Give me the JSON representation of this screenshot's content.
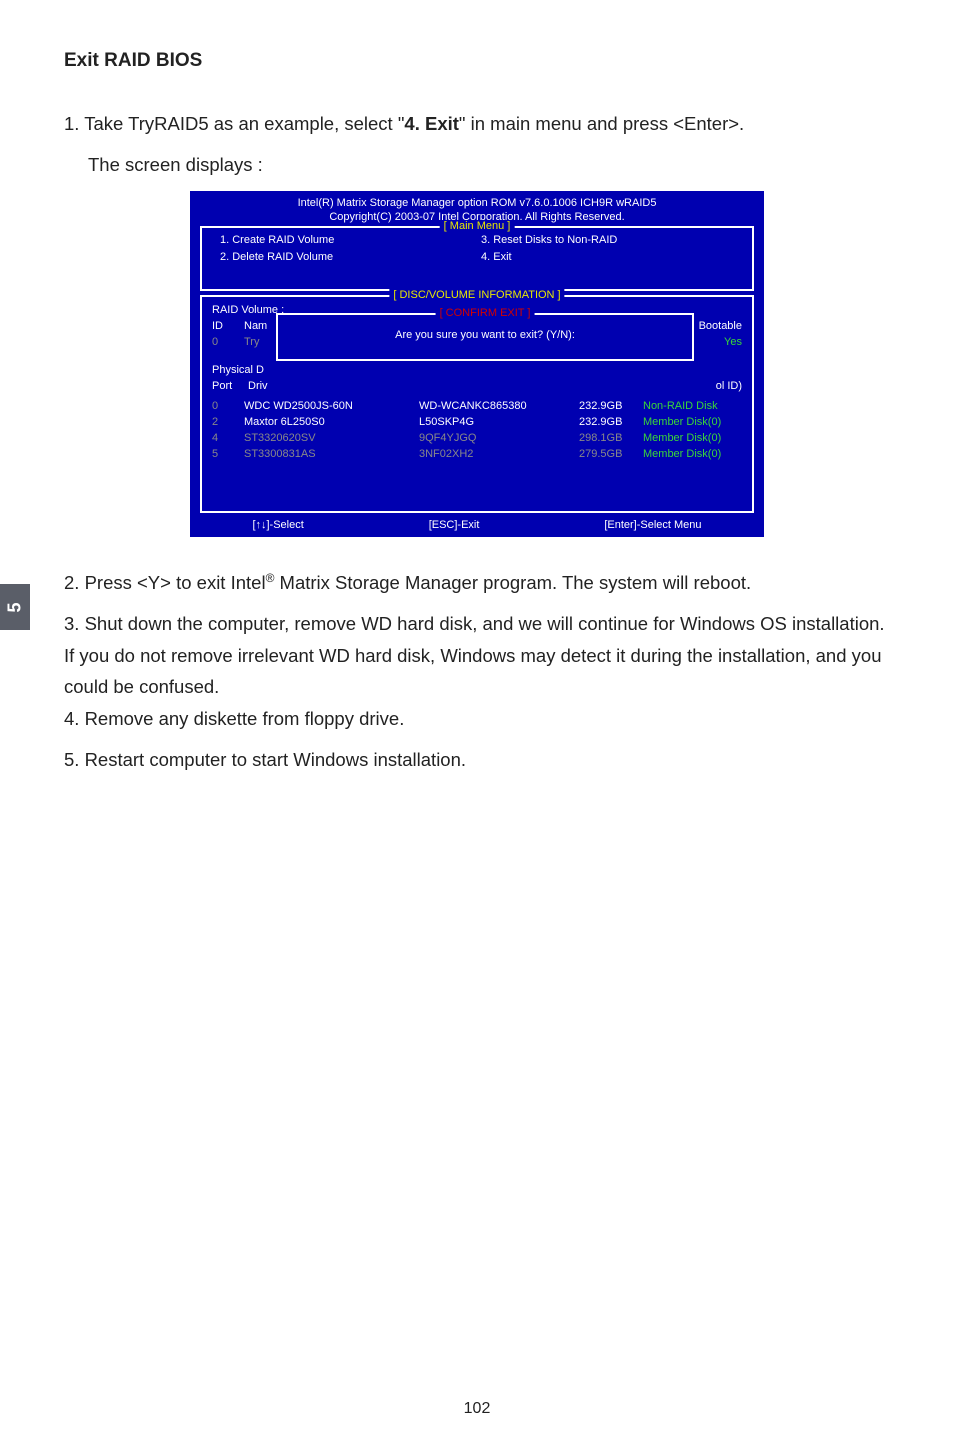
{
  "page": {
    "heading": "Exit RAID BIOS",
    "intro_prefix": "1. Take TryRAID5 as an example, select \"",
    "intro_bold": "4. Exit",
    "intro_suffix": "\" in main menu and press <Enter>.",
    "intro_line2": "The screen displays :",
    "side_tab": "5",
    "page_number": "102"
  },
  "bios": {
    "header1": "Intel(R) Matrix Storage Manager option ROM v7.6.0.1006 ICH9R wRAID5",
    "header2": "Copyright(C) 2003-07 Intel Corporation.   All Rights Reserved.",
    "main_menu_title": "[ Main Menu ]",
    "menu": {
      "m1": "1. Create RAID Volume",
      "m2": "2. Delete RAID Volume",
      "m3": "3. Reset Disks to Non-RAID",
      "m4": "4. Exit"
    },
    "disc_title": "[ DISC/VOLUME INFORMATION ]",
    "raid_volume_label": "RAID Volume :",
    "col_id": "ID",
    "col_nam": "Nam",
    "col_boot": "Bootable",
    "vol_id0": "0",
    "vol_try": "Try",
    "vol_yes": "Yes",
    "physical_label": "Physical D",
    "port_label": "Port",
    "driv_label": "Driv",
    "volid_tail": "ol ID)",
    "confirm_title": "[ CONFIRM EXIT ]",
    "confirm_text": "Are you sure you want to exit? (Y/N):",
    "disks": [
      {
        "port": "0",
        "model": "WDC WD2500JS-60N",
        "serial": "WD-WCANKC865380",
        "size": "232.9GB",
        "status": "Non-RAID Disk"
      },
      {
        "port": "2",
        "model": "Maxtor 6L250S0",
        "serial": "L50SKP4G",
        "size": "232.9GB",
        "status": "Member Disk(0)"
      },
      {
        "port": "4",
        "model": "ST3320620SV",
        "serial": "9QF4YJGQ",
        "size": "298.1GB",
        "status": "Member Disk(0)"
      },
      {
        "port": "5",
        "model": "ST3300831AS",
        "serial": "3NF02XH2",
        "size": "279.5GB",
        "status": "Member Disk(0)"
      }
    ],
    "footer": {
      "select": "[↑↓]-Select",
      "esc": "[ESC]-Exit",
      "enter": "[Enter]-Select Menu"
    }
  },
  "post": {
    "i2a": "2. Press <Y> to exit Intel",
    "sup": "®",
    "i2b": " Matrix Storage Manager program. The system will reboot.",
    "i3": "3. Shut down the computer, remove WD hard disk, and we will continue for Windows OS installation. If you do not remove irrelevant WD hard disk, Windows may detect it during the installation, and you could be confused.",
    "i4": "4. Remove any diskette from floppy drive.",
    "i5": "5. Restart computer to start Windows installation."
  }
}
